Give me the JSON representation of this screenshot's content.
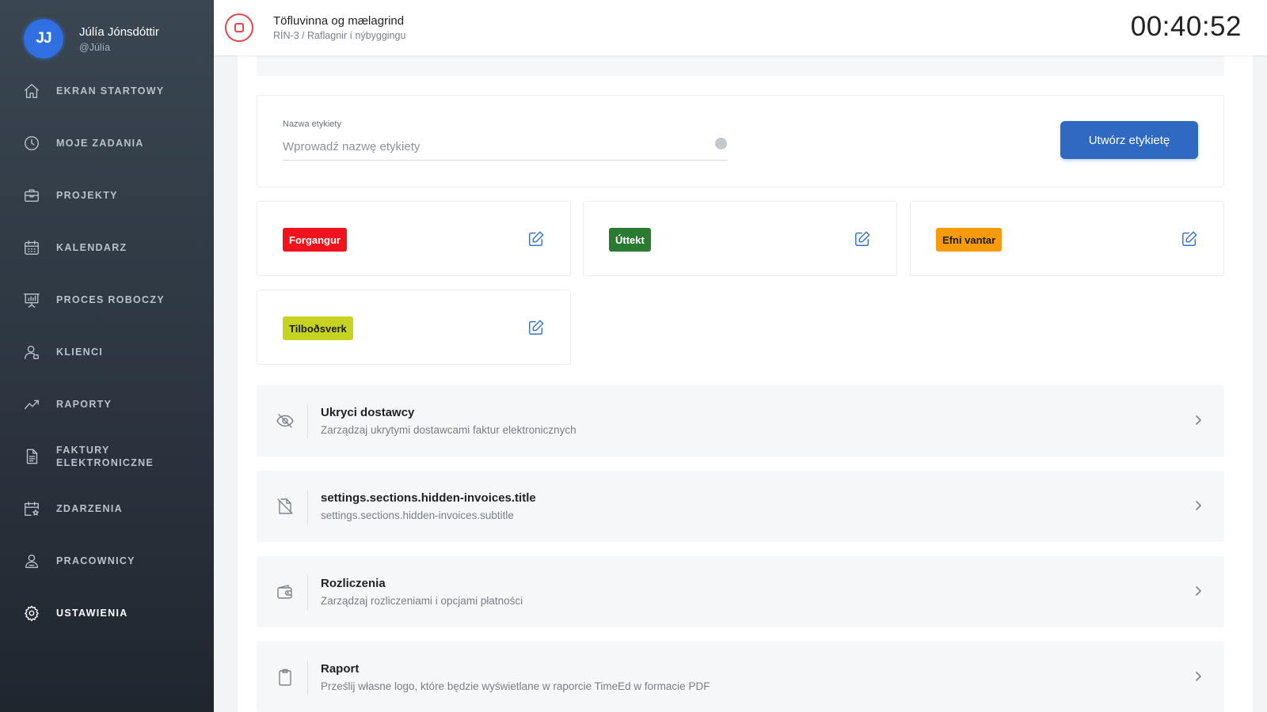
{
  "user": {
    "initials": "JJ",
    "name": "Júlía Jónsdóttir",
    "handle": "@Júlía"
  },
  "nav": [
    {
      "label": "EKRAN STARTOWY",
      "icon": "home-icon"
    },
    {
      "label": "MOJE ZADANIA",
      "icon": "clock-icon"
    },
    {
      "label": "PROJEKTY",
      "icon": "briefcase-icon"
    },
    {
      "label": "KALENDARZ",
      "icon": "calendar-icon"
    },
    {
      "label": "PROCES ROBOCZY",
      "icon": "presentation-board-icon"
    },
    {
      "label": "KLIENCI",
      "icon": "user-icon"
    },
    {
      "label": "RAPORTY",
      "icon": "trend-chart-icon"
    },
    {
      "label": "FAKTURY ELEKTRONICZNE",
      "icon": "document-icon"
    },
    {
      "label": "ZDARZENIA",
      "icon": "calendar-star-icon"
    },
    {
      "label": "PRACOWNICY",
      "icon": "users-icon"
    },
    {
      "label": "USTAWIENIA",
      "icon": "gear-icon",
      "active": true
    }
  ],
  "header": {
    "task_title": "Töfluvinna og mælagrind",
    "task_sub": "RÍN-3 / Raflagnir í nýbyggingu",
    "timer": "00:40:52"
  },
  "create_label": {
    "field_label": "Nazwa etykiety",
    "placeholder": "Wprowadź nazwę etykiety",
    "button": "Utwórz etykietę"
  },
  "labels": [
    {
      "text": "Forgangur",
      "bg": "#f0121c",
      "fg": "#ffffff"
    },
    {
      "text": "Úttekt",
      "bg": "#2a7a32",
      "fg": "#ffffff"
    },
    {
      "text": "Efni vantar",
      "bg": "#f79a0c",
      "fg": "#1d1d1d"
    },
    {
      "text": "Tilboðsverk",
      "bg": "#c6d320",
      "fg": "#1d1d1d"
    }
  ],
  "sections": [
    {
      "title": "Ukryci dostawcy",
      "subtitle": "Zarządzaj ukrytymi dostawcami faktur elektronicznych",
      "icon": "eye-off-icon"
    },
    {
      "title": "settings.sections.hidden-invoices.title",
      "subtitle": "settings.sections.hidden-invoices.subtitle",
      "icon": "file-off-icon"
    },
    {
      "title": "Rozliczenia",
      "subtitle": "Zarządzaj rozliczeniami i opcjami płatności",
      "icon": "wallet-icon"
    },
    {
      "title": "Raport",
      "subtitle": "Prześlij własne logo, które będzie wyświetlane w raporcie TimeEd w formacie PDF",
      "icon": "clipboard-icon"
    }
  ],
  "colors": {
    "accent": "#2f69c1",
    "stop": "#e2454a",
    "edit": "#3a72c9"
  }
}
